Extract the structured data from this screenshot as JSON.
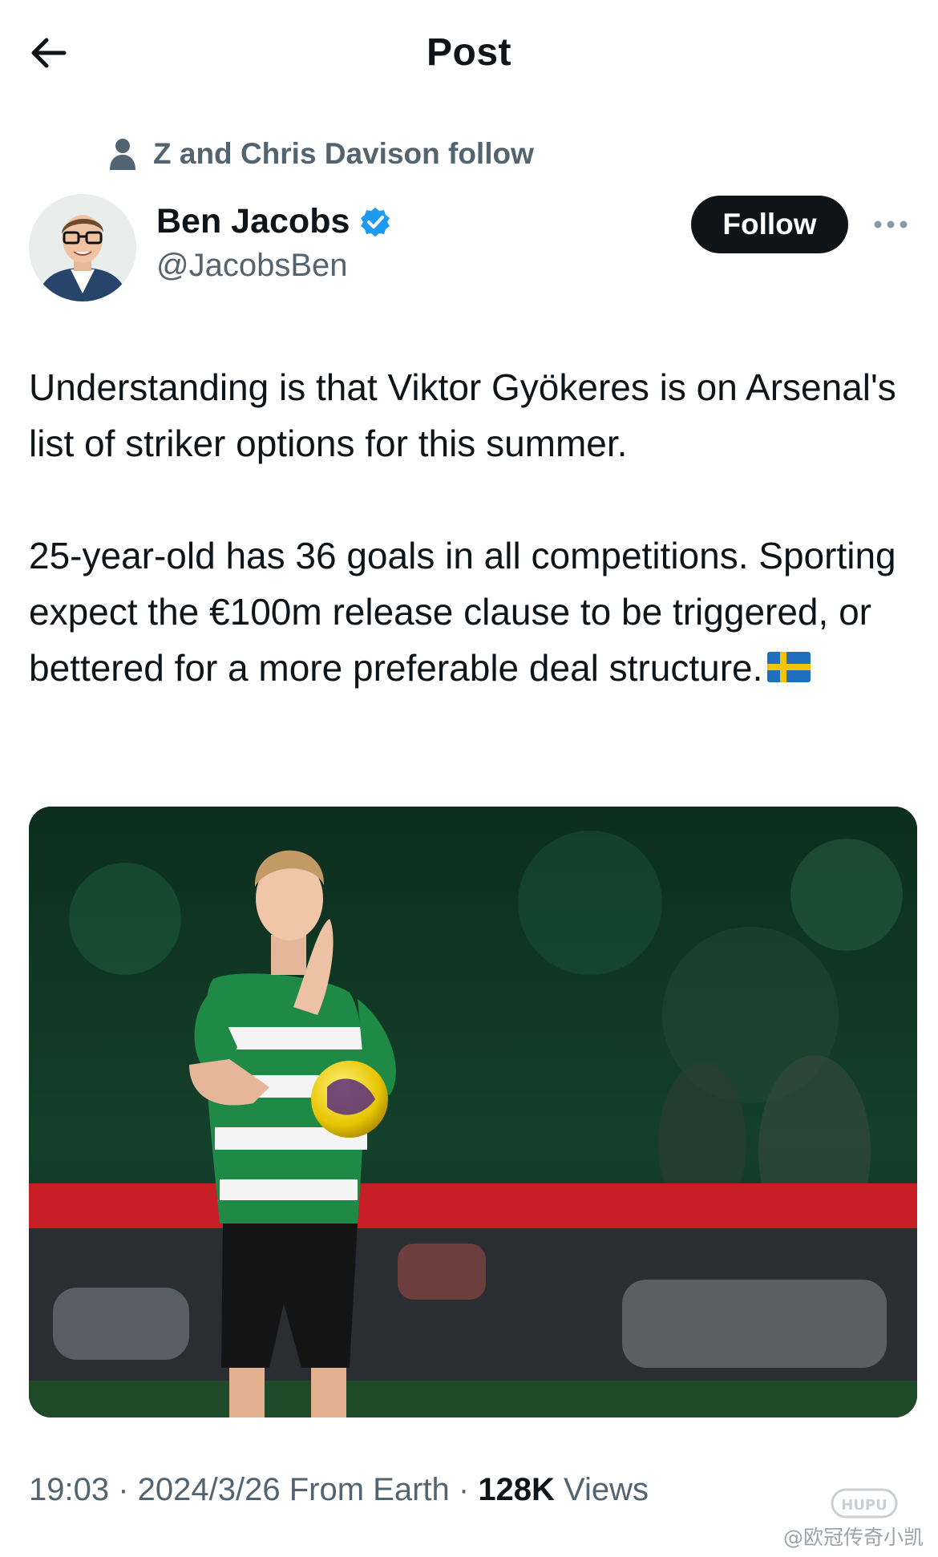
{
  "header": {
    "title": "Post",
    "back_icon": "arrow-left-icon"
  },
  "social_context": {
    "text": "Z and Chris Davison follow",
    "icon": "person-icon"
  },
  "author": {
    "name": "Ben Jacobs",
    "handle": "@JacobsBen",
    "verified": true,
    "verified_color": "#1d9bf0"
  },
  "actions": {
    "follow_label": "Follow",
    "more_icon": "more-dots-icon"
  },
  "tweet": {
    "paragraph1": "Understanding is that Viktor Gyökeres is on Arsenal's list of striker options for this summer.",
    "paragraph2": "25-year-old has 36 goals in all competitions. Sporting expect the €100m release clause to be triggered, or bettered for a more preferable deal structure.",
    "emoji": "sweden-flag"
  },
  "media": {
    "type": "photo",
    "icon": "player-photo"
  },
  "meta": {
    "time": "19:03",
    "sep1": " · ",
    "date": "2024/3/26",
    "location": " From Earth",
    "sep2": " · ",
    "views_count": "128K",
    "views_label": " Views"
  },
  "watermark": {
    "text": "@欧冠传奇小凯",
    "logo_text": "HUPU"
  },
  "colors": {
    "text": "#0f1419",
    "secondary": "#536471",
    "accent": "#1d9bf0"
  }
}
